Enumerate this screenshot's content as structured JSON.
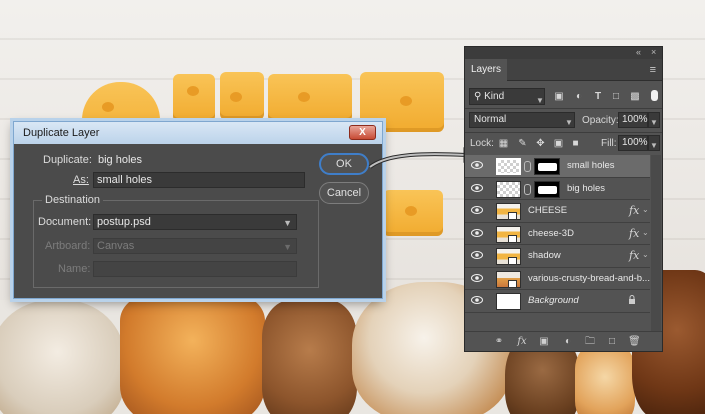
{
  "dialog": {
    "title": "Duplicate Layer",
    "close_glyph": "X",
    "duplicate_label": "Duplicate:",
    "duplicate_value": "big holes",
    "as_label": "As:",
    "as_value": "small holes",
    "destination_label": "Destination",
    "document_label": "Document:",
    "document_value": "postup.psd",
    "artboard_label": "Artboard:",
    "artboard_value": "Canvas",
    "name_label": "Name:",
    "name_value": "",
    "ok_label": "OK",
    "cancel_label": "Cancel"
  },
  "panel": {
    "tab_label": "Layers",
    "filter_kind": "Kind",
    "blend_mode": "Normal",
    "opacity_label": "Opacity:",
    "opacity_value": "100%",
    "lock_label": "Lock:",
    "fill_label": "Fill:",
    "fill_value": "100%",
    "layers": [
      {
        "name": "small holes",
        "selected": true
      },
      {
        "name": "big holes",
        "selected": false
      },
      {
        "name": "CHEESE",
        "fx": true
      },
      {
        "name": "cheese-3D",
        "fx": true
      },
      {
        "name": "shadow",
        "fx": true
      },
      {
        "name": "various-crusty-bread-and-b...",
        "fx": false
      },
      {
        "name": "Background",
        "locked": true
      }
    ]
  },
  "colors": {
    "accent": "#3f7ec9",
    "panel_bg": "#535353",
    "dialog_bg": "#4b4b4b",
    "title_bar": "#bcd3ea"
  }
}
